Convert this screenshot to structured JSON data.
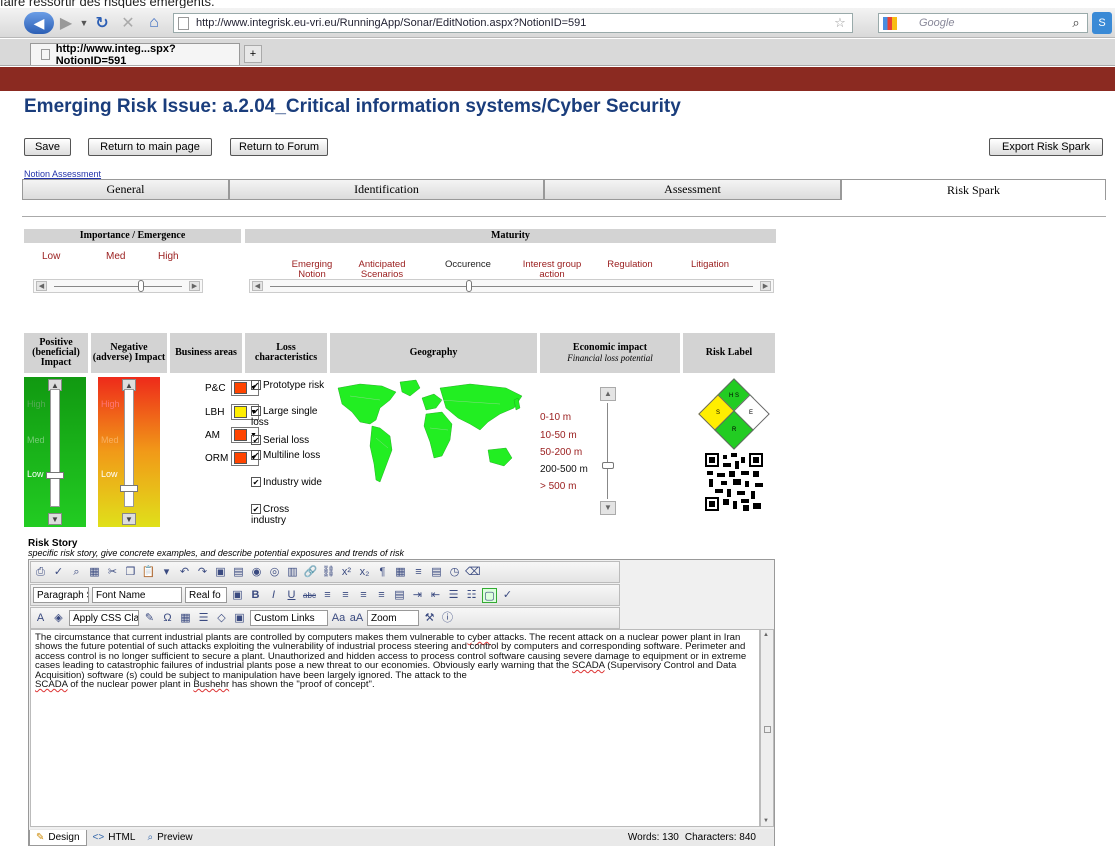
{
  "caption": "faire ressortir des risques émergents.",
  "browser": {
    "url": "http://www.integrisk.eu-vri.eu/RunningApp/Sonar/EditNotion.aspx?NotionID=591",
    "search_placeholder": "Google",
    "tab_title": "http://www.integ...spx?NotionID=591",
    "new_tab": "+"
  },
  "page": {
    "title": "Emerging Risk Issue: a.2.04_Critical information systems/Cyber Security",
    "buttons": {
      "save": "Save",
      "return_main": "Return to main page",
      "return_forum": "Return to Forum",
      "export": "Export Risk Spark"
    },
    "notion_link": "Notion Assessment",
    "tabs": [
      {
        "label": "General"
      },
      {
        "label": "Identification"
      },
      {
        "label": "Assessment"
      },
      {
        "label": "Risk Spark"
      }
    ]
  },
  "importance": {
    "header": "Importance / Emergence",
    "labels": [
      "Low",
      "Med",
      "High"
    ]
  },
  "maturity": {
    "header": "Maturity",
    "labels": [
      "Emerging Notion",
      "Anticipated Scenarios",
      "Occurence",
      "Interest group action",
      "Regulation",
      "Litigation"
    ]
  },
  "columns": {
    "positive": "Positive (beneficial) Impact",
    "negative": "Negative (adverse) Impact",
    "business": "Business areas",
    "loss": "Loss characteristics",
    "geography": "Geography",
    "economic": "Economic impact",
    "economic_sub": "Financial loss potential",
    "risk_label": "Risk Label"
  },
  "impact_levels": [
    "High",
    "Med",
    "Low"
  ],
  "business_areas": [
    {
      "code": "P&C",
      "color": "#ff4400"
    },
    {
      "code": "LBH",
      "color": "#ffee00"
    },
    {
      "code": "AM",
      "color": "#ff4400"
    },
    {
      "code": "ORM",
      "color": "#ff4400"
    }
  ],
  "loss_characteristics": [
    "Prototype risk",
    "Large single loss",
    "Serial loss",
    "Multiline loss",
    "Industry wide",
    "Cross industry"
  ],
  "economic_levels": [
    "0-10 m",
    "10-50 m",
    "50-200 m",
    "200-500 m",
    "> 500 m"
  ],
  "risk_label_cells": [
    "H S",
    "S",
    "E",
    "R"
  ],
  "editor": {
    "title": "Risk Story",
    "hint": "specific risk story, give concrete examples, and describe potential exposures and trends of risk",
    "paragraph_style": "Paragraph Style",
    "font_name": "Font Name",
    "font_size": "Real fo",
    "css_class": "Apply CSS Clas",
    "custom_links": "Custom Links",
    "zoom": "Zoom",
    "text_1": "The circumstance that current industrial plants are controlled by computers makes them vulnerable to",
    "text_cyber": "cyber",
    "text_2": "attacks. The recent attack on a nuclear power plant in Iran shows the future potential of such attacks exploiting the vulnerability of industrial process steering and control by computers and corresponding software. Perimeter and access control is no longer sufficient to secure a plant. Unauthorized and hidden access to process control software causing severe damage to equipment or in extreme cases leading to catastrophic failures of industrial plants pose a new threat to our economies. Obviously early warning that the",
    "text_scada": "SCADA",
    "text_3": "(Supervisory Control and Data Acquisition) software (s) could be subject to manipulation have been largely ignored. The attack to the",
    "text_scada2": "SCADA",
    "text_4": "of the nuclear power plant in",
    "text_bushehr": "Bushehr",
    "text_5": "has shown the \"proof of concept\".",
    "modes": [
      "Design",
      "HTML",
      "Preview"
    ],
    "words": "Words: 130",
    "chars": "Characters: 840"
  },
  "colors": {
    "maroon": "#8b2a21",
    "title": "#1a3d7c",
    "red_label": "#9b2020"
  }
}
